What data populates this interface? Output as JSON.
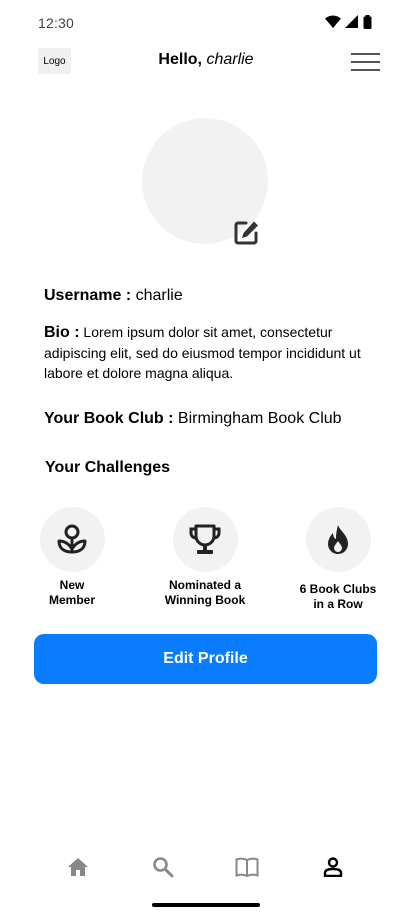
{
  "status_bar": {
    "time": "12:30",
    "icons": [
      "wifi-icon",
      "signal-icon",
      "battery-icon"
    ]
  },
  "header": {
    "logo": "Logo",
    "greeting_hello": "Hello, ",
    "greeting_name": "charlie",
    "menu_icon": "hamburger-menu-icon"
  },
  "profile": {
    "avatar_edit_icon": "edit-icon",
    "username_label": "Username :",
    "username_value": " charlie",
    "bio_label": "Bio :",
    "bio_value": " Lorem ipsum dolor sit amet, consectetur adipiscing elit, sed do eiusmod tempor incididunt ut labore et dolore magna aliqua.",
    "book_club_label": "Your Book Club :",
    "book_club_value": " Birmingham Book Club"
  },
  "challenges": {
    "title": "Your Challenges",
    "items": [
      {
        "icon": "sprout-icon",
        "line1": "New",
        "line2": "Member"
      },
      {
        "icon": "trophy-icon",
        "line1": "Nominated a",
        "line2": "Winning Book"
      },
      {
        "icon": "flame-icon",
        "line1": "6 Book Clubs",
        "line2": "in a Row"
      }
    ]
  },
  "actions": {
    "edit_profile": "Edit Profile"
  },
  "bottom_nav": {
    "items": [
      {
        "icon": "home-icon",
        "active": false
      },
      {
        "icon": "search-icon",
        "active": false
      },
      {
        "icon": "book-icon",
        "active": false
      },
      {
        "icon": "profile-icon",
        "active": true
      }
    ]
  },
  "colors": {
    "accent": "#0a7cff",
    "placeholder_bg": "#f2f2f2",
    "icon_dark": "#333333",
    "nav_inactive": "#888888"
  }
}
